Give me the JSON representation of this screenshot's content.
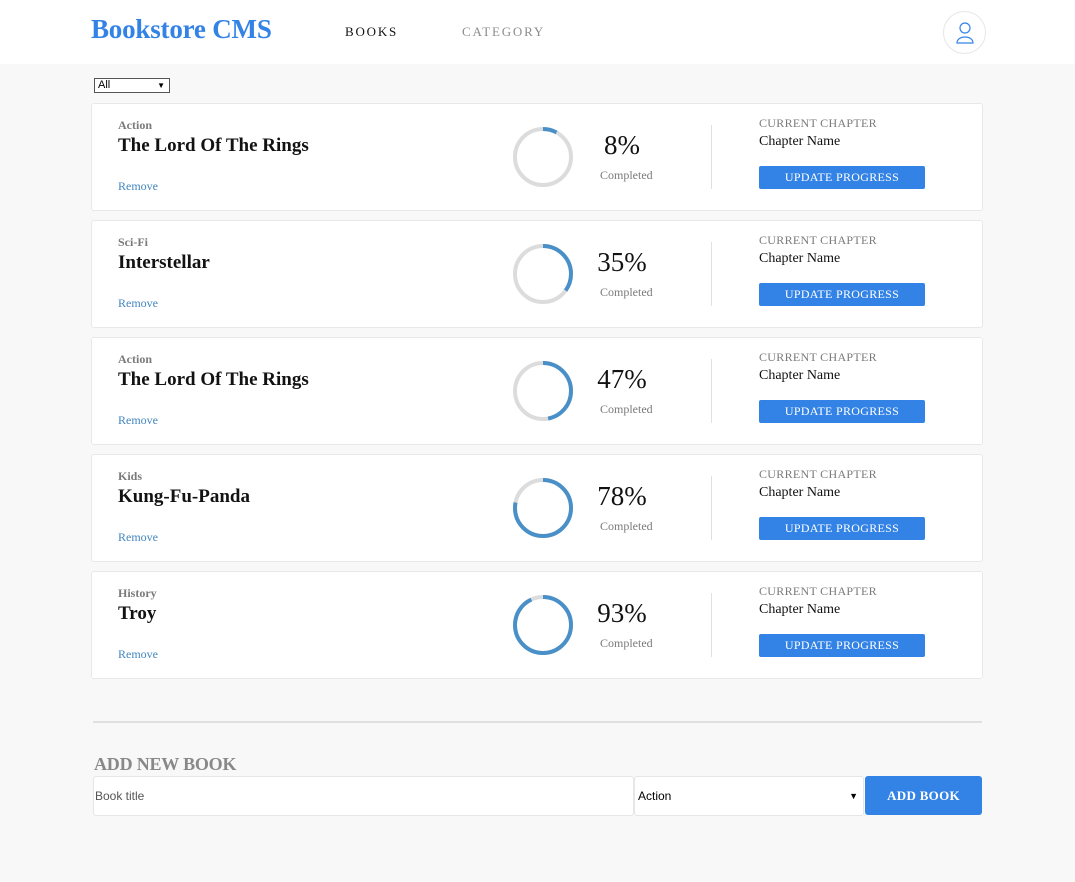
{
  "header": {
    "logo": "Bookstore CMS",
    "nav": [
      {
        "label": "BOOKS",
        "active": true
      },
      {
        "label": "CATEGORY",
        "active": false
      }
    ],
    "avatar_icon": "user-icon"
  },
  "filter": {
    "selected": "All"
  },
  "books": [
    {
      "genre": "Action",
      "title": "The Lord Of The Rings",
      "progress": 8,
      "progress_label": "8%",
      "completed_label": "Completed",
      "current_chapter_label": "CURRENT CHAPTER",
      "chapter": "Chapter Name",
      "update_label": "UPDATE PROGRESS",
      "remove_label": "Remove"
    },
    {
      "genre": "Sci-Fi",
      "title": "Interstellar",
      "progress": 35,
      "progress_label": "35%",
      "completed_label": "Completed",
      "current_chapter_label": "CURRENT CHAPTER",
      "chapter": "Chapter Name",
      "update_label": "UPDATE PROGRESS",
      "remove_label": "Remove"
    },
    {
      "genre": "Action",
      "title": "The Lord Of The Rings",
      "progress": 47,
      "progress_label": "47%",
      "completed_label": "Completed",
      "current_chapter_label": "CURRENT CHAPTER",
      "chapter": "Chapter Name",
      "update_label": "UPDATE PROGRESS",
      "remove_label": "Remove"
    },
    {
      "genre": "Kids",
      "title": "Kung-Fu-Panda",
      "progress": 78,
      "progress_label": "78%",
      "completed_label": "Completed",
      "current_chapter_label": "CURRENT CHAPTER",
      "chapter": "Chapter Name",
      "update_label": "UPDATE PROGRESS",
      "remove_label": "Remove"
    },
    {
      "genre": "History",
      "title": "Troy",
      "progress": 93,
      "progress_label": "93%",
      "completed_label": "Completed",
      "current_chapter_label": "CURRENT CHAPTER",
      "chapter": "Chapter Name",
      "update_label": "UPDATE PROGRESS",
      "remove_label": "Remove"
    }
  ],
  "add_form": {
    "heading": "ADD NEW BOOK",
    "title_placeholder": "Book title",
    "category_selected": "Action",
    "submit_label": "ADD BOOK"
  },
  "colors": {
    "accent": "#3383e6",
    "ring_progress": "#4a90c8",
    "ring_track": "#dcdcdc"
  }
}
